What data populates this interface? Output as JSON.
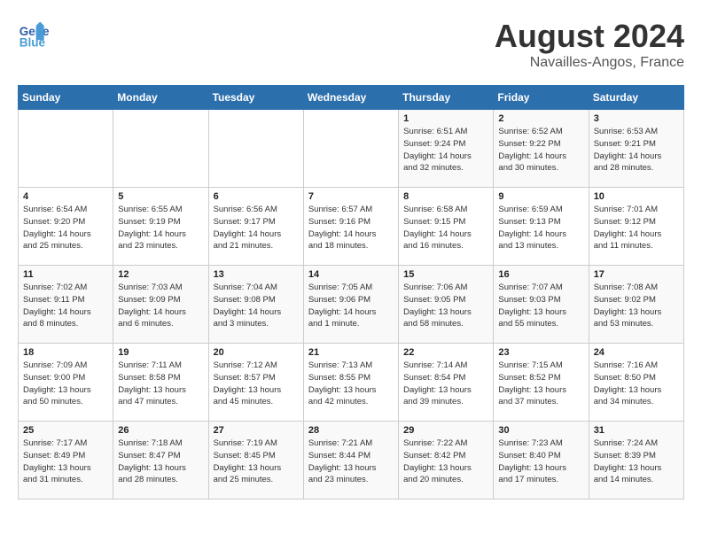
{
  "header": {
    "logo_line1": "General",
    "logo_line2": "Blue",
    "month_title": "August 2024",
    "location": "Navailles-Angos, France"
  },
  "weekdays": [
    "Sunday",
    "Monday",
    "Tuesday",
    "Wednesday",
    "Thursday",
    "Friday",
    "Saturday"
  ],
  "weeks": [
    [
      {
        "day": "",
        "info": ""
      },
      {
        "day": "",
        "info": ""
      },
      {
        "day": "",
        "info": ""
      },
      {
        "day": "",
        "info": ""
      },
      {
        "day": "1",
        "info": "Sunrise: 6:51 AM\nSunset: 9:24 PM\nDaylight: 14 hours\nand 32 minutes."
      },
      {
        "day": "2",
        "info": "Sunrise: 6:52 AM\nSunset: 9:22 PM\nDaylight: 14 hours\nand 30 minutes."
      },
      {
        "day": "3",
        "info": "Sunrise: 6:53 AM\nSunset: 9:21 PM\nDaylight: 14 hours\nand 28 minutes."
      }
    ],
    [
      {
        "day": "4",
        "info": "Sunrise: 6:54 AM\nSunset: 9:20 PM\nDaylight: 14 hours\nand 25 minutes."
      },
      {
        "day": "5",
        "info": "Sunrise: 6:55 AM\nSunset: 9:19 PM\nDaylight: 14 hours\nand 23 minutes."
      },
      {
        "day": "6",
        "info": "Sunrise: 6:56 AM\nSunset: 9:17 PM\nDaylight: 14 hours\nand 21 minutes."
      },
      {
        "day": "7",
        "info": "Sunrise: 6:57 AM\nSunset: 9:16 PM\nDaylight: 14 hours\nand 18 minutes."
      },
      {
        "day": "8",
        "info": "Sunrise: 6:58 AM\nSunset: 9:15 PM\nDaylight: 14 hours\nand 16 minutes."
      },
      {
        "day": "9",
        "info": "Sunrise: 6:59 AM\nSunset: 9:13 PM\nDaylight: 14 hours\nand 13 minutes."
      },
      {
        "day": "10",
        "info": "Sunrise: 7:01 AM\nSunset: 9:12 PM\nDaylight: 14 hours\nand 11 minutes."
      }
    ],
    [
      {
        "day": "11",
        "info": "Sunrise: 7:02 AM\nSunset: 9:11 PM\nDaylight: 14 hours\nand 8 minutes."
      },
      {
        "day": "12",
        "info": "Sunrise: 7:03 AM\nSunset: 9:09 PM\nDaylight: 14 hours\nand 6 minutes."
      },
      {
        "day": "13",
        "info": "Sunrise: 7:04 AM\nSunset: 9:08 PM\nDaylight: 14 hours\nand 3 minutes."
      },
      {
        "day": "14",
        "info": "Sunrise: 7:05 AM\nSunset: 9:06 PM\nDaylight: 14 hours\nand 1 minute."
      },
      {
        "day": "15",
        "info": "Sunrise: 7:06 AM\nSunset: 9:05 PM\nDaylight: 13 hours\nand 58 minutes."
      },
      {
        "day": "16",
        "info": "Sunrise: 7:07 AM\nSunset: 9:03 PM\nDaylight: 13 hours\nand 55 minutes."
      },
      {
        "day": "17",
        "info": "Sunrise: 7:08 AM\nSunset: 9:02 PM\nDaylight: 13 hours\nand 53 minutes."
      }
    ],
    [
      {
        "day": "18",
        "info": "Sunrise: 7:09 AM\nSunset: 9:00 PM\nDaylight: 13 hours\nand 50 minutes."
      },
      {
        "day": "19",
        "info": "Sunrise: 7:11 AM\nSunset: 8:58 PM\nDaylight: 13 hours\nand 47 minutes."
      },
      {
        "day": "20",
        "info": "Sunrise: 7:12 AM\nSunset: 8:57 PM\nDaylight: 13 hours\nand 45 minutes."
      },
      {
        "day": "21",
        "info": "Sunrise: 7:13 AM\nSunset: 8:55 PM\nDaylight: 13 hours\nand 42 minutes."
      },
      {
        "day": "22",
        "info": "Sunrise: 7:14 AM\nSunset: 8:54 PM\nDaylight: 13 hours\nand 39 minutes."
      },
      {
        "day": "23",
        "info": "Sunrise: 7:15 AM\nSunset: 8:52 PM\nDaylight: 13 hours\nand 37 minutes."
      },
      {
        "day": "24",
        "info": "Sunrise: 7:16 AM\nSunset: 8:50 PM\nDaylight: 13 hours\nand 34 minutes."
      }
    ],
    [
      {
        "day": "25",
        "info": "Sunrise: 7:17 AM\nSunset: 8:49 PM\nDaylight: 13 hours\nand 31 minutes."
      },
      {
        "day": "26",
        "info": "Sunrise: 7:18 AM\nSunset: 8:47 PM\nDaylight: 13 hours\nand 28 minutes."
      },
      {
        "day": "27",
        "info": "Sunrise: 7:19 AM\nSunset: 8:45 PM\nDaylight: 13 hours\nand 25 minutes."
      },
      {
        "day": "28",
        "info": "Sunrise: 7:21 AM\nSunset: 8:44 PM\nDaylight: 13 hours\nand 23 minutes."
      },
      {
        "day": "29",
        "info": "Sunrise: 7:22 AM\nSunset: 8:42 PM\nDaylight: 13 hours\nand 20 minutes."
      },
      {
        "day": "30",
        "info": "Sunrise: 7:23 AM\nSunset: 8:40 PM\nDaylight: 13 hours\nand 17 minutes."
      },
      {
        "day": "31",
        "info": "Sunrise: 7:24 AM\nSunset: 8:39 PM\nDaylight: 13 hours\nand 14 minutes."
      }
    ]
  ]
}
